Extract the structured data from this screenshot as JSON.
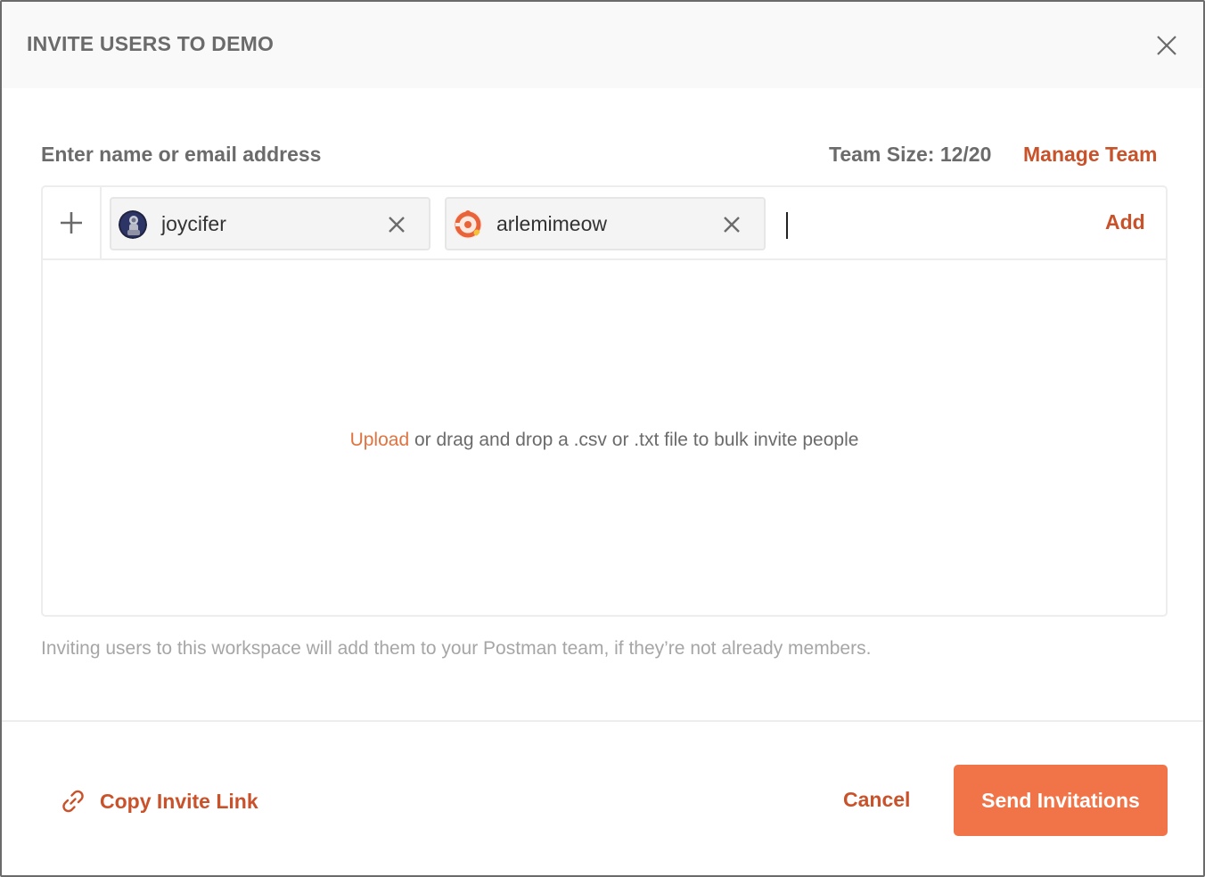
{
  "dialog": {
    "title": "INVITE USERS TO DEMO",
    "close_icon": "close-icon"
  },
  "invite": {
    "field_label": "Enter name or email address",
    "team_size": "Team Size: 12/20",
    "manage_team_label": "Manage Team",
    "plus_icon": "plus-icon",
    "chips": [
      {
        "name": "joycifer",
        "avatar_icon": "user-avatar-astronaut"
      },
      {
        "name": "arlemimeow",
        "avatar_icon": "user-avatar-orange-swirl"
      }
    ],
    "input_value": "",
    "add_label": "Add"
  },
  "upload": {
    "link_label": "Upload",
    "text": " or drag and drop a .csv or .txt file to bulk invite people"
  },
  "note": "Inviting users to this workspace will add them to your Postman team, if they’re not already members.",
  "footer": {
    "copy_link_label": "Copy Invite Link",
    "copy_link_icon": "link-icon",
    "cancel_label": "Cancel",
    "send_label": "Send Invitations"
  },
  "colors": {
    "accent": "#c9522a",
    "primary_button": "#f07447",
    "upload_link": "#e0733f"
  }
}
